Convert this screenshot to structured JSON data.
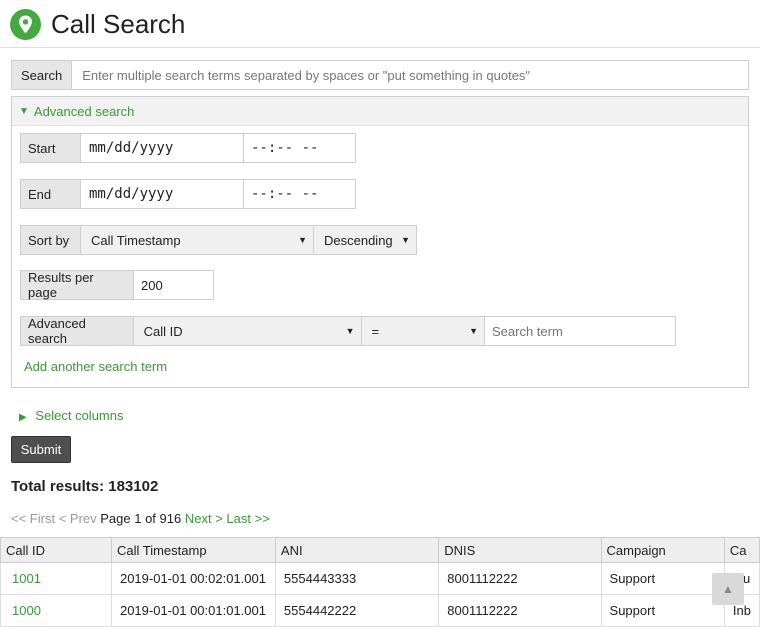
{
  "page": {
    "title": "Call Search"
  },
  "search": {
    "label": "Search",
    "placeholder": "Enter multiple search terms separated by spaces or \"put something in quotes\""
  },
  "advanced": {
    "toggle_label": "Advanced search",
    "start": {
      "label": "Start",
      "date": "mm/dd/yyyy",
      "time": "--:-- --"
    },
    "end": {
      "label": "End",
      "date": "mm/dd/yyyy",
      "time": "--:-- --"
    },
    "sort": {
      "label": "Sort by",
      "field": "Call Timestamp",
      "order": "Descending"
    },
    "per_page": {
      "label": "Results per page",
      "value": "200"
    },
    "term": {
      "label": "Advanced search",
      "field": "Call ID",
      "operator": "=",
      "placeholder": "Search term"
    },
    "add_term": "Add another search term"
  },
  "columns_toggle": "Select columns",
  "submit_label": "Submit",
  "total_label": "Total results: 183102",
  "pager": {
    "first": "<< First",
    "prev": "< Prev",
    "page_text": "Page 1 of 916",
    "next": "Next >",
    "last": "Last >>"
  },
  "table": {
    "headers": [
      "Call ID",
      "Call Timestamp",
      "ANI",
      "DNIS",
      "Campaign",
      "Ca"
    ],
    "rows": [
      [
        "1001",
        "2019-01-01 00:02:01.001",
        "5554443333",
        "8001112222",
        "Support",
        "Qu"
      ],
      [
        "1000",
        "2019-01-01 00:01:01.001",
        "5554442222",
        "8001112222",
        "Support",
        "Inb"
      ]
    ]
  },
  "icons": {
    "logo": "location-pin-icon",
    "scroll_top": "arrow-up-icon"
  },
  "colors": {
    "accent": "#3a9b35",
    "logo": "#44a940",
    "submit": "#4f4f4f"
  }
}
